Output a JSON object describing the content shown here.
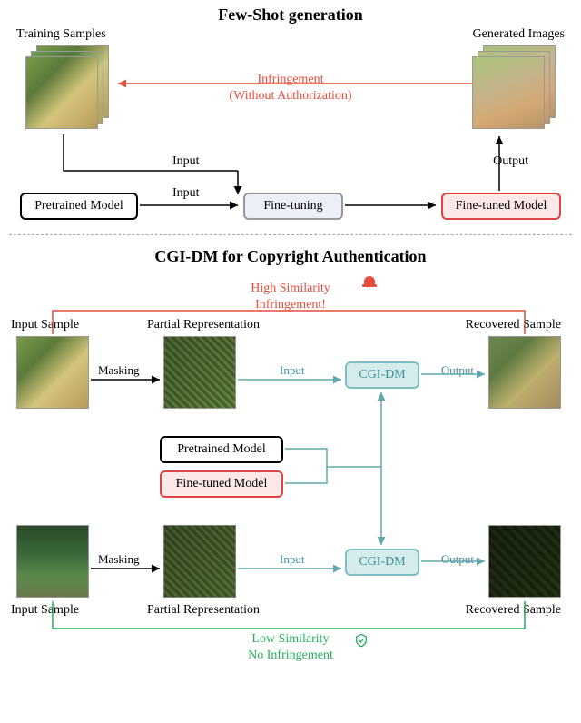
{
  "section1": {
    "title": "Few-Shot generation",
    "training_label": "Training Samples",
    "generated_label": "Generated Images",
    "infringement_line1": "Infringement",
    "infringement_line2": "(Without Authorization)",
    "input_label1": "Input",
    "input_label2": "Input",
    "output_label": "Output",
    "pretrained": "Pretrained Model",
    "finetuning": "Fine-tuning",
    "finetuned": "Fine-tuned Model"
  },
  "section2": {
    "title": "CGI-DM for Copyright Authentication",
    "high_sim": "High Similarity",
    "infringement": "Infringement!",
    "low_sim": "Low Similarity",
    "no_infringement": "No Infringement",
    "input_sample": "Input Sample",
    "partial_rep": "Partial Representation",
    "recovered": "Recovered Sample",
    "masking": "Masking",
    "input": "Input",
    "output": "Output",
    "cgi": "CGI-DM",
    "pretrained": "Pretrained Model",
    "finetuned": "Fine-tuned Model"
  }
}
